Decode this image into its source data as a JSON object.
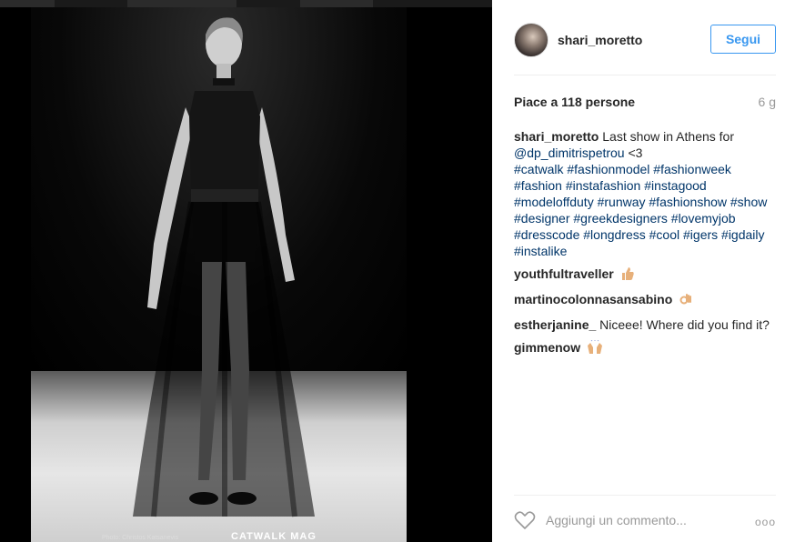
{
  "post": {
    "username": "shari_moretto",
    "follow_label": "Segui",
    "likes_text": "Piace a 118 persone",
    "age": "6 g",
    "photo_credit": "Photo: Christos Katsanevis",
    "photo_logo": "CATWALK MAG"
  },
  "caption": {
    "user": "shari_moretto",
    "text_before": " Last show in Athens for ",
    "mention": "@dp_dimitrispetrou",
    "text_after": " <3",
    "hashtags": "#catwalk #fashionmodel #fashionweek #fashion #instafashion #instagood #modeloffduty #runway #fashionshow #show #designer #greekdesigners #lovemyjob #dresscode #longdress #cool #igers #igdaily #instalike"
  },
  "comments": [
    {
      "user": "youthfultraveller",
      "text": "",
      "emoji": "thumbs-up-icon"
    },
    {
      "user": "martinocolonnasansabino",
      "text": "",
      "emoji": "ok-hand-icon"
    },
    {
      "user": "estherjanine_",
      "text": " Niceee! Where did you find it?",
      "emoji": ""
    },
    {
      "user": "gimmenow",
      "text": "",
      "emoji": "raised-hands-icon"
    }
  ],
  "footer": {
    "add_comment_placeholder": "Aggiungi un commento...",
    "more_label": "ooo"
  },
  "colors": {
    "follow_blue": "#3897f0",
    "link": "#003569",
    "text": "#262626",
    "muted": "#999999"
  }
}
